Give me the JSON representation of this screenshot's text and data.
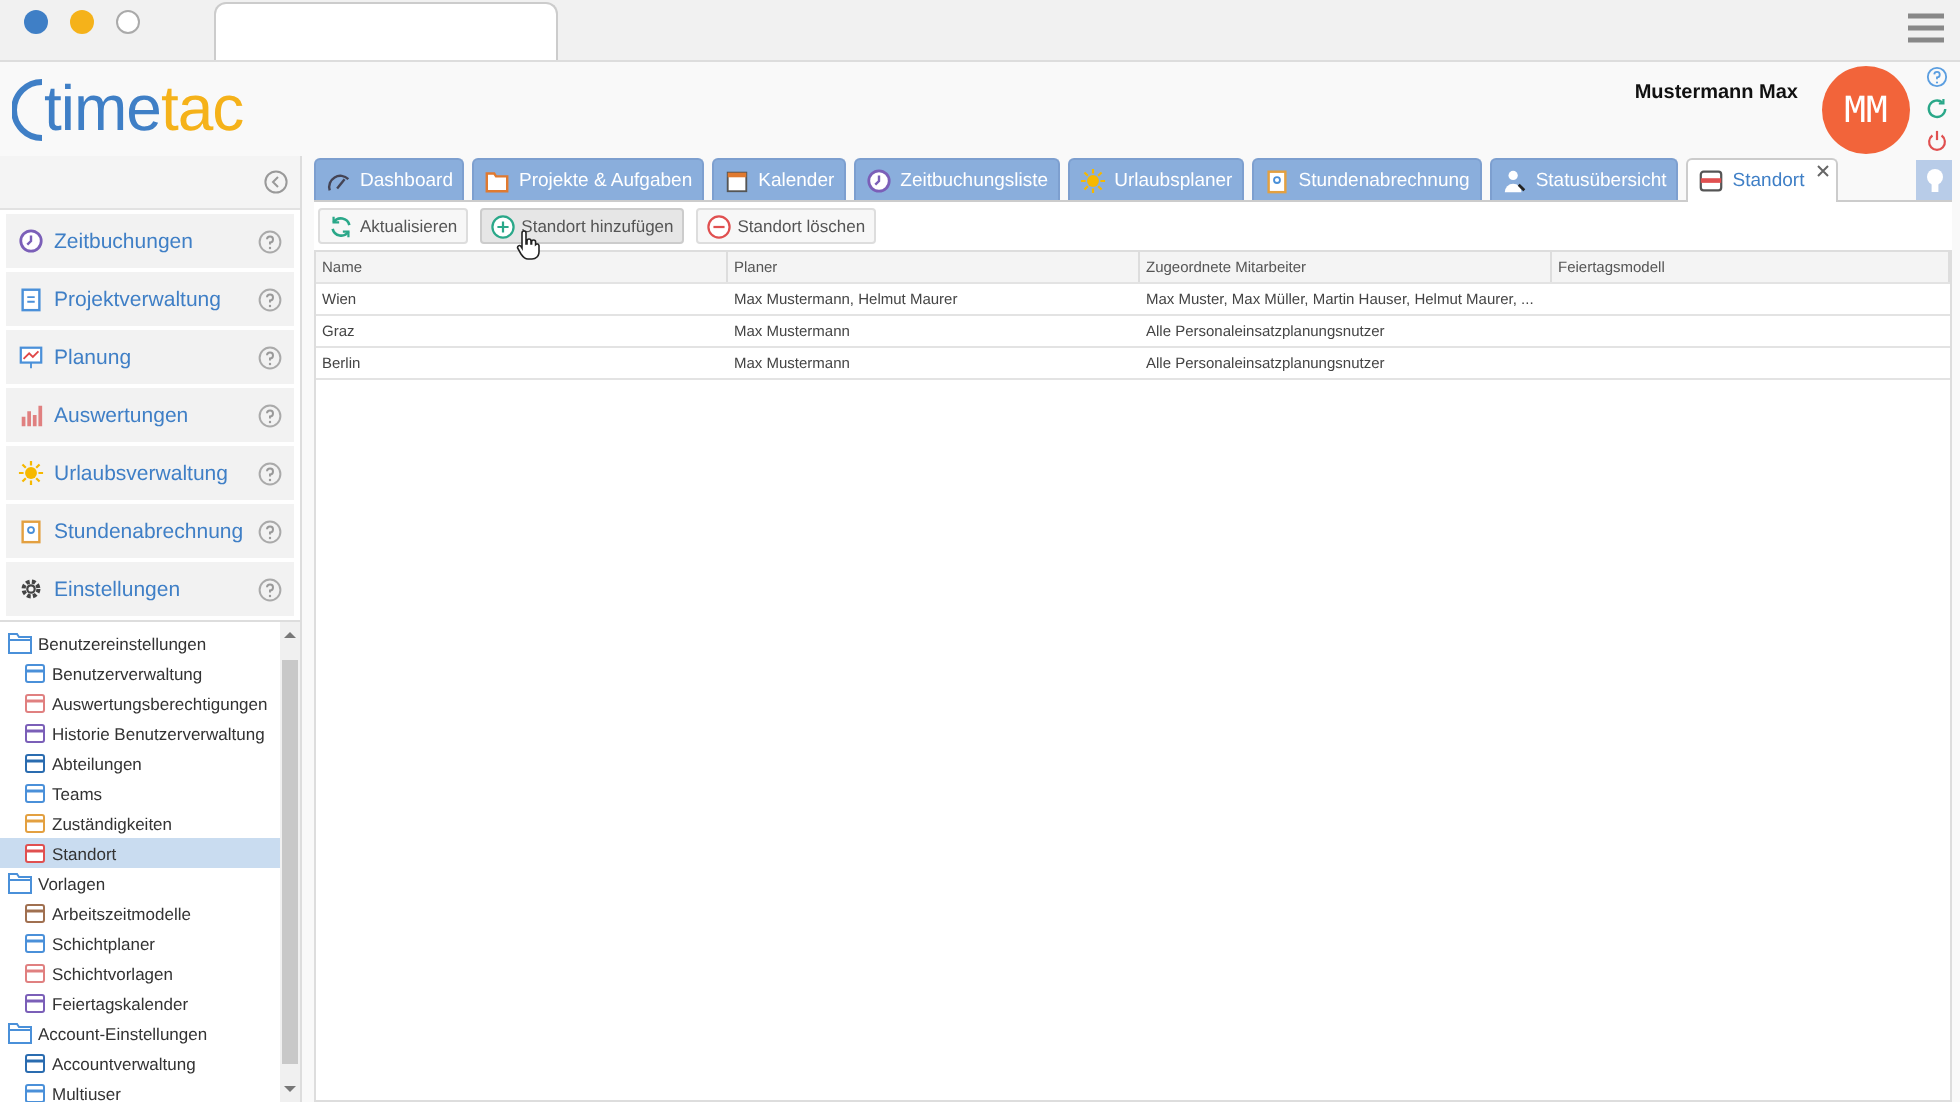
{
  "logo": {
    "primary": "time",
    "accent": "tac"
  },
  "user": {
    "name": "Mustermann Max",
    "initials": "MM"
  },
  "sidebar": {
    "menu": [
      {
        "label": "Zeitbuchungen",
        "kind": "clock"
      },
      {
        "label": "Projektverwaltung",
        "kind": "clipboard"
      },
      {
        "label": "Planung",
        "kind": "chart"
      },
      {
        "label": "Auswertungen",
        "kind": "bars"
      },
      {
        "label": "Urlaubsverwaltung",
        "kind": "sun"
      },
      {
        "label": "Stundenabrechnung",
        "kind": "badge"
      },
      {
        "label": "Einstellungen",
        "kind": "gear"
      }
    ],
    "tree": [
      {
        "label": "Benutzereinstellungen",
        "selected": false,
        "children": [
          {
            "label": "Benutzerverwaltung",
            "selected": false
          },
          {
            "label": "Auswertungsberechtigungen",
            "selected": false
          },
          {
            "label": "Historie Benutzerverwaltung",
            "selected": false
          },
          {
            "label": "Abteilungen",
            "selected": false
          },
          {
            "label": "Teams",
            "selected": false
          },
          {
            "label": "Zuständigkeiten",
            "selected": false
          },
          {
            "label": "Standort",
            "selected": true
          }
        ]
      },
      {
        "label": "Vorlagen",
        "selected": false,
        "children": [
          {
            "label": "Arbeitszeitmodelle",
            "selected": false
          },
          {
            "label": "Schichtplaner",
            "selected": false
          },
          {
            "label": "Schichtvorlagen",
            "selected": false
          },
          {
            "label": "Feiertagskalender",
            "selected": false
          }
        ]
      },
      {
        "label": "Account-Einstellungen",
        "selected": false,
        "children": [
          {
            "label": "Accountverwaltung",
            "selected": false
          },
          {
            "label": "Multiuser",
            "selected": false
          }
        ]
      }
    ]
  },
  "tabs": [
    {
      "label": "Dashboard",
      "kind": "gauge",
      "selected": false
    },
    {
      "label": "Projekte & Aufgaben",
      "kind": "folder",
      "selected": false
    },
    {
      "label": "Kalender",
      "kind": "calendar",
      "selected": false
    },
    {
      "label": "Zeitbuchungsliste",
      "kind": "clock",
      "selected": false
    },
    {
      "label": "Urlaubsplaner",
      "kind": "sun",
      "selected": false
    },
    {
      "label": "Stundenabrechnung",
      "kind": "badge",
      "selected": false
    },
    {
      "label": "Statusübersicht",
      "kind": "person",
      "selected": false
    },
    {
      "label": "Standort",
      "kind": "box",
      "selected": true
    }
  ],
  "toolbar": [
    {
      "label": "Aktualisieren",
      "kind": "refresh",
      "hovered": false
    },
    {
      "label": "Standort hinzufügen",
      "kind": "add",
      "hovered": true
    },
    {
      "label": "Standort löschen",
      "kind": "remove",
      "hovered": false
    }
  ],
  "table": {
    "columns": [
      "Name",
      "Planer",
      "Zugeordnete Mitarbeiter",
      "Feiertagsmodell"
    ],
    "rows": [
      [
        "Wien",
        "Max Mustermann, Helmut Maurer",
        "Max Muster, Max Müller, Martin Hauser, Helmut Maurer, ...",
        ""
      ],
      [
        "Graz",
        "Max Mustermann",
        "Alle Personaleinsatzplanungsnutzer",
        ""
      ],
      [
        "Berlin",
        "Max Mustermann",
        "Alle Personaleinsatzplanungsnutzer",
        ""
      ]
    ]
  }
}
